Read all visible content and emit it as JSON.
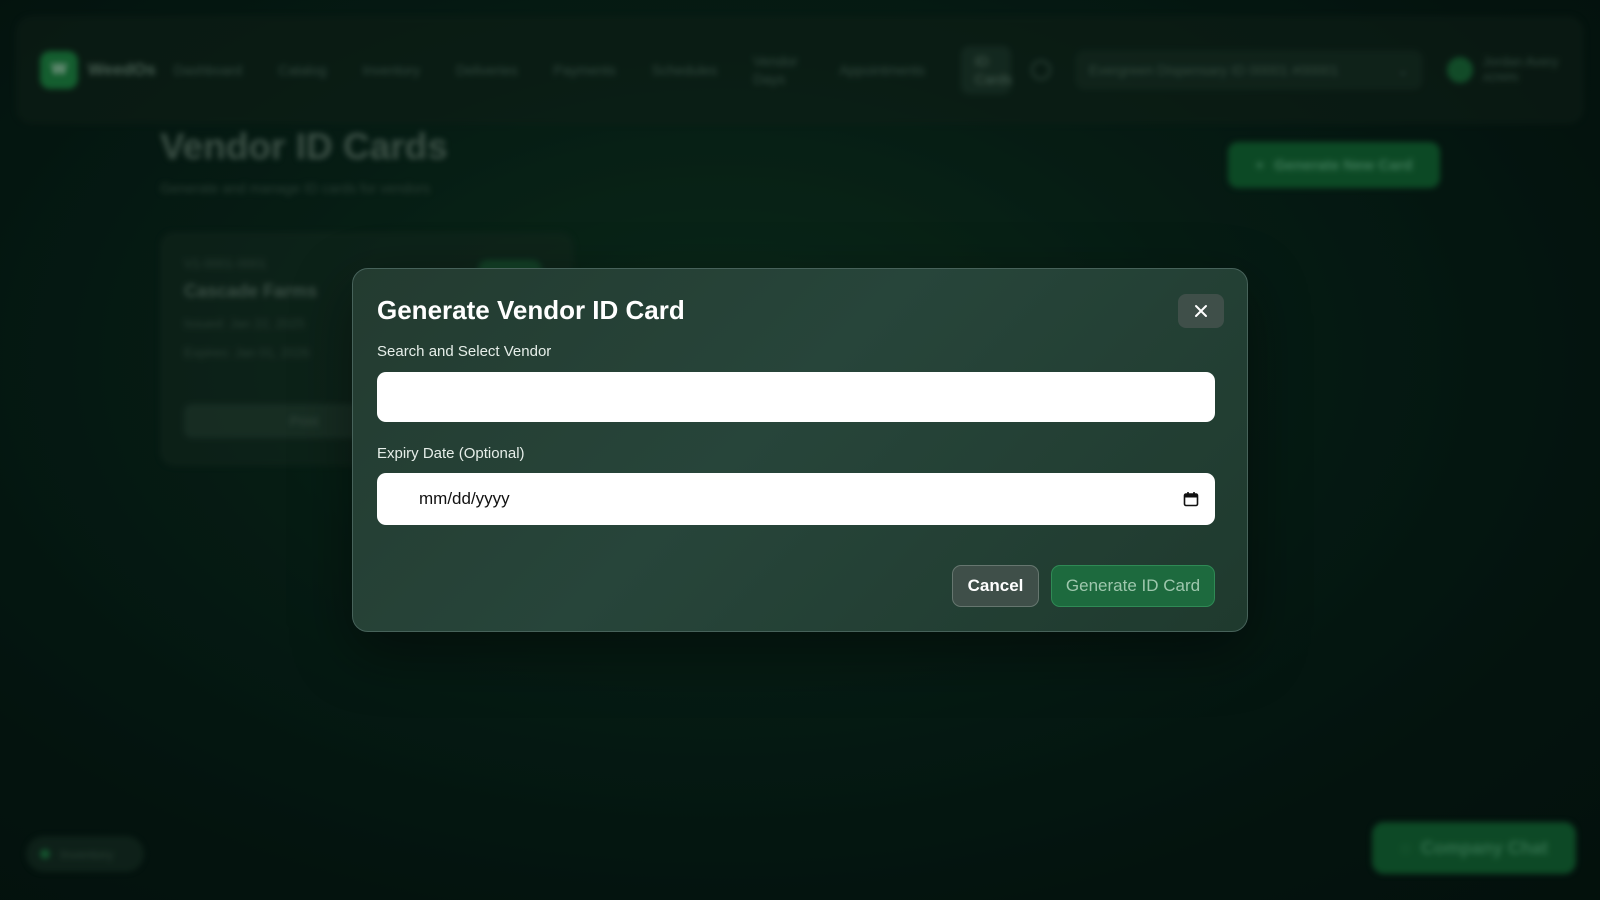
{
  "background": {
    "brand": "WeedOs",
    "nav": [
      "Dashboard",
      "Catalog",
      "Inventory",
      "Deliveries",
      "Payments",
      "Schedules",
      "Vendor Days",
      "Appointments",
      "ID Cards"
    ],
    "dispensary": "Evergreen Dispensary ID 00001 #00001",
    "user_name": "Jordan Avery",
    "user_role": "ADMIN",
    "page_title": "Vendor ID Cards",
    "page_subtitle": "Generate and manage ID cards for vendors",
    "generate_new_label": "Generate New Card",
    "card": {
      "id": "V1-0001-0001",
      "vendor": "Cascade Farms",
      "issued": "Issued: Jan 22, 2025",
      "expires": "Expires: Jan 01, 2026",
      "print_label": "Print"
    },
    "bottom_chip": "Inventory",
    "company_chat": "Company Chat"
  },
  "modal": {
    "title": "Generate Vendor ID Card",
    "search_label": "Search and Select Vendor",
    "search_value": "",
    "search_placeholder": "",
    "expiry_label": "Expiry Date (Optional)",
    "expiry_placeholder": "mm/dd/yyyy",
    "cancel_label": "Cancel",
    "generate_label": "Generate ID Card"
  },
  "colors": {
    "accent": "#1d6a3e",
    "modal_bg": "#233b30",
    "page_bg": "#08251a"
  },
  "icons": {
    "close": "close-icon",
    "calendar": "calendar-icon",
    "plus": "plus-icon",
    "chat": "chat-icon"
  }
}
